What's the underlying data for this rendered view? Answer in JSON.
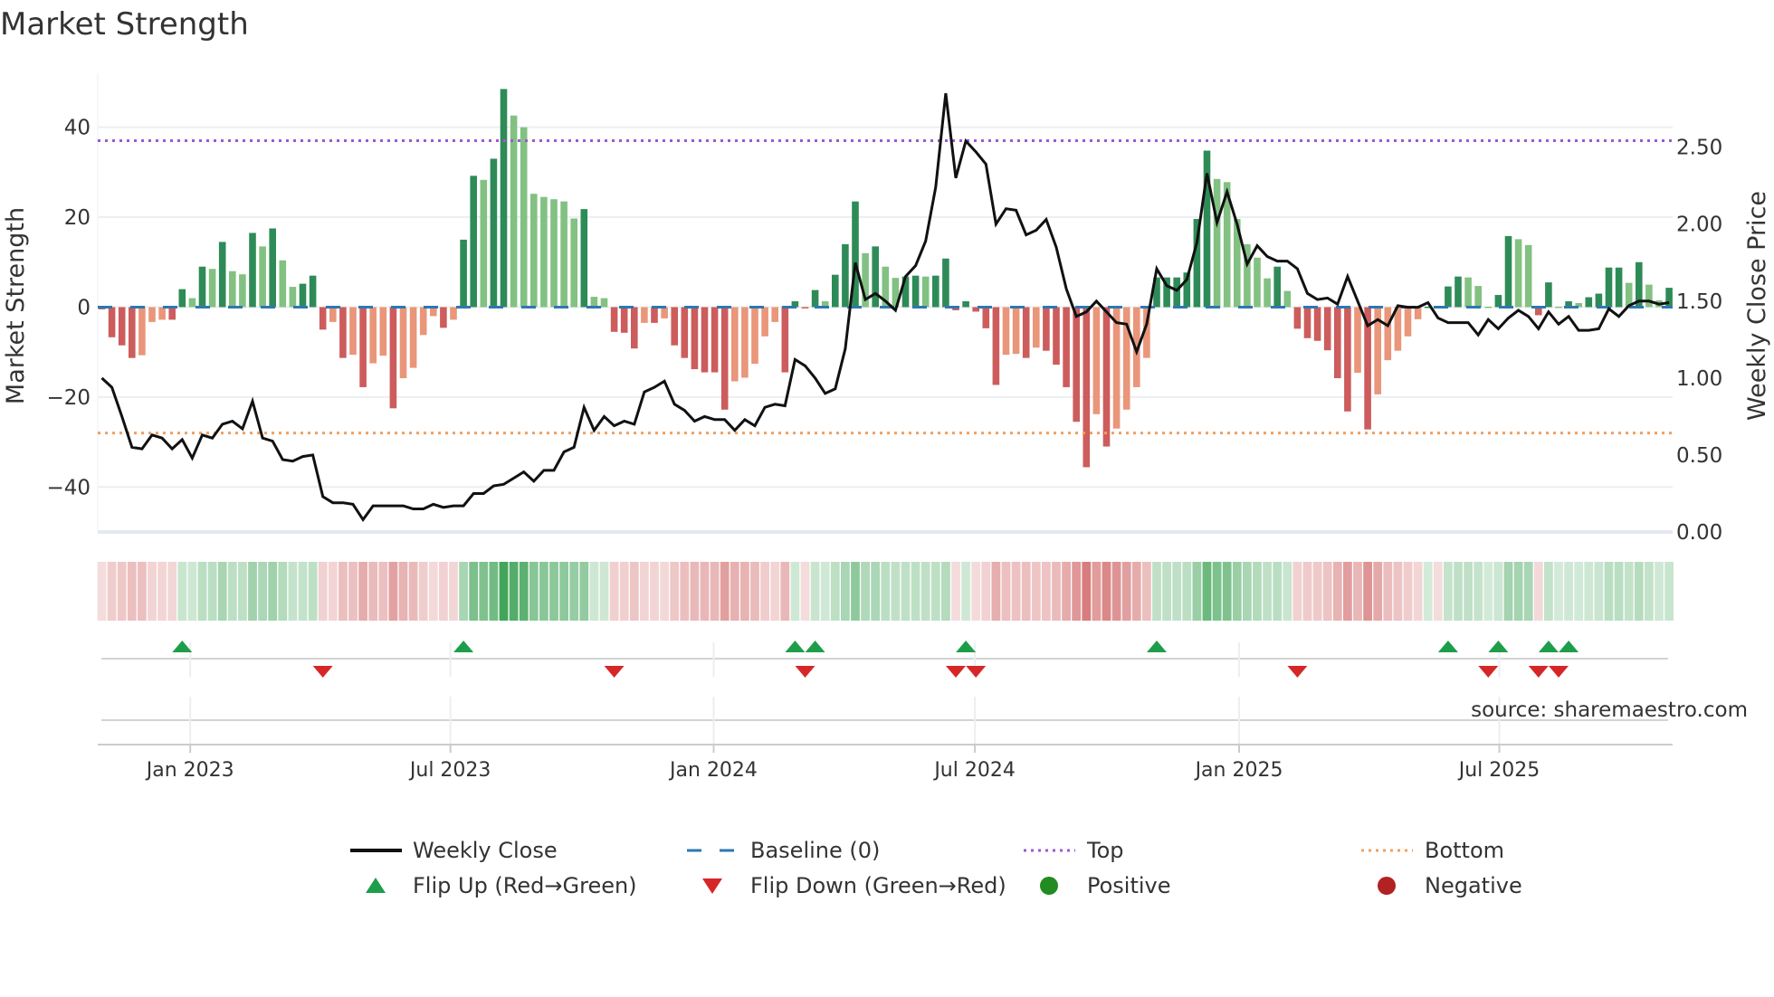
{
  "chart_data": {
    "type": "bar",
    "title": "Market Strength",
    "ylabel": "Market Strength",
    "y2label": "Weekly Close Price",
    "ylim": [
      -50,
      52
    ],
    "y2lim": [
      0,
      2.98
    ],
    "yticks": [
      -40,
      -20,
      0,
      20,
      40
    ],
    "yticklabels": [
      "−40",
      "−20",
      "0",
      "20",
      "40"
    ],
    "y2ticks": [
      0,
      0.5,
      1.0,
      1.5,
      2.0,
      2.5
    ],
    "y2ticklabels": [
      "0.00",
      "0.50",
      "1.00",
      "1.50",
      "2.00",
      "2.50"
    ],
    "x_frequency": "weekly",
    "xticks": [
      {
        "week": 8.8,
        "label": "Jan 2023"
      },
      {
        "week": 34.7,
        "label": "Jul 2023"
      },
      {
        "week": 60.9,
        "label": "Jan 2024"
      },
      {
        "week": 86.9,
        "label": "Jul 2024"
      },
      {
        "week": 113.2,
        "label": "Jan 2025"
      },
      {
        "week": 139.1,
        "label": "Jul 2025"
      }
    ],
    "top_level": 37,
    "bottom_level": -28,
    "baseline": 0,
    "strength": [
      -0.5,
      -6.7,
      -8.5,
      -11.3,
      -10.7,
      -3.3,
      -2.8,
      -2.8,
      4,
      2,
      9,
      8.5,
      14.5,
      8,
      7.3,
      16.5,
      13.5,
      17.5,
      10.4,
      4.5,
      5.2,
      7,
      -5,
      -3.3,
      -11.3,
      -10.6,
      -17.8,
      -12.5,
      -10.8,
      -22.5,
      -15.8,
      -13.5,
      -6.2,
      -2,
      -4.6,
      -2.8,
      15,
      29.2,
      28.3,
      33,
      48.5,
      42.6,
      40,
      25.2,
      24.5,
      24,
      23.5,
      19.7,
      21.8,
      2.3,
      2,
      -5.5,
      -5.7,
      -9.2,
      -3.5,
      -3.5,
      -2.5,
      -8.5,
      -11.3,
      -13.8,
      -14.5,
      -14.5,
      -22.8,
      -16.5,
      -15.7,
      -12.6,
      -6.5,
      -3.3,
      -14.5,
      1.3,
      -0.3,
      3.8,
      1.3,
      7.2,
      14,
      23.5,
      12,
      13.5,
      9,
      6.5,
      6.8,
      7,
      6.8,
      7,
      10.8,
      -0.7,
      1.3,
      -1,
      -4.7,
      -17.3,
      -10.6,
      -10.4,
      -11.3,
      -9,
      -9.7,
      -12.8,
      -17.8,
      -25.5,
      -35.6,
      -23.8,
      -31,
      -27,
      -22.8,
      -17.8,
      -11.3,
      6.6,
      6.6,
      6.6,
      7.7,
      19.6,
      34.8,
      28.5,
      27.8,
      19.6,
      14,
      11,
      6.4,
      9,
      3.6,
      -4.8,
      -6.9,
      -7.5,
      -9.6,
      -15.8,
      -23.2,
      -14.6,
      -27.2,
      -19.4,
      -11.8,
      -9.7,
      -6.5,
      -2.7,
      0.1,
      -0.3,
      4.6,
      6.8,
      6.6,
      4.7,
      0.1,
      2.7,
      15.8,
      15.1,
      13.8,
      -1.8,
      5.5,
      0.1,
      1.3,
      0.9,
      2.2,
      3,
      8.8,
      8.8,
      5.4,
      10,
      5,
      1.5,
      4.3
    ],
    "close": [
      1.0,
      0.94,
      0.75,
      0.55,
      0.54,
      0.63,
      0.61,
      0.54,
      0.6,
      0.48,
      0.63,
      0.61,
      0.7,
      0.72,
      0.67,
      0.85,
      0.61,
      0.59,
      0.47,
      0.46,
      0.49,
      0.5,
      0.23,
      0.19,
      0.19,
      0.18,
      0.08,
      0.17,
      0.17,
      0.17,
      0.17,
      0.15,
      0.15,
      0.18,
      0.16,
      0.17,
      0.17,
      0.25,
      0.25,
      0.3,
      0.31,
      0.35,
      0.39,
      0.33,
      0.4,
      0.4,
      0.52,
      0.55,
      0.81,
      0.66,
      0.75,
      0.69,
      0.72,
      0.7,
      0.91,
      0.94,
      0.98,
      0.83,
      0.79,
      0.72,
      0.75,
      0.73,
      0.73,
      0.66,
      0.73,
      0.69,
      0.81,
      0.83,
      0.82,
      1.12,
      1.08,
      1.0,
      0.9,
      0.93,
      1.19,
      1.75,
      1.51,
      1.55,
      1.5,
      1.44,
      1.66,
      1.73,
      1.89,
      2.24,
      2.85,
      2.3,
      2.54,
      2.47,
      2.39,
      2.0,
      2.1,
      2.09,
      1.93,
      1.96,
      2.03,
      1.85,
      1.58,
      1.4,
      1.43,
      1.5,
      1.43,
      1.36,
      1.35,
      1.17,
      1.35,
      1.71,
      1.6,
      1.57,
      1.64,
      1.88,
      2.33,
      2.01,
      2.21,
      2.0,
      1.74,
      1.86,
      1.79,
      1.76,
      1.76,
      1.71,
      1.55,
      1.51,
      1.52,
      1.48,
      1.66,
      1.5,
      1.34,
      1.38,
      1.34,
      1.47,
      1.46,
      1.46,
      1.49,
      1.39,
      1.36,
      1.36,
      1.36,
      1.28,
      1.38,
      1.32,
      1.39,
      1.44,
      1.4,
      1.32,
      1.43,
      1.35,
      1.4,
      1.31,
      1.31,
      1.32,
      1.45,
      1.4,
      1.47,
      1.5,
      1.5,
      1.48,
      1.49
    ],
    "flip_up_weeks": [
      8,
      36,
      69,
      71,
      86,
      105,
      134,
      139,
      144,
      146
    ],
    "flip_down_weeks": [
      22,
      51,
      70,
      85,
      87,
      119,
      138,
      143,
      145
    ],
    "legend": [
      {
        "label": "Weekly Close",
        "kind": "line",
        "color": "#111111"
      },
      {
        "label": "Baseline (0)",
        "kind": "dash",
        "color": "#2e78b0"
      },
      {
        "label": "Top",
        "kind": "dot",
        "color": "#9b59d0"
      },
      {
        "label": "Bottom",
        "kind": "dot",
        "color": "#f0a060"
      },
      {
        "label": "Flip Up (Red→Green)",
        "kind": "tri-up",
        "color": "#1e9e4a"
      },
      {
        "label": "Flip Down (Green→Red)",
        "kind": "tri-down",
        "color": "#d62728"
      },
      {
        "label": "Positive",
        "kind": "dot-marker",
        "color": "#228b22"
      },
      {
        "label": "Negative",
        "kind": "dot-marker",
        "color": "#b22222"
      }
    ],
    "legend_position": "bottom-center",
    "source": "source: sharemaestro.com",
    "colors": {
      "pos_strong": "#2e8b57",
      "pos_weak": "#82c182",
      "neg_strong": "#cd5c5c",
      "neg_weak": "#e9967a",
      "line": "#111111",
      "baseline": "#2e78b0",
      "top": "#9b59d0",
      "bottom": "#f0a060"
    }
  }
}
